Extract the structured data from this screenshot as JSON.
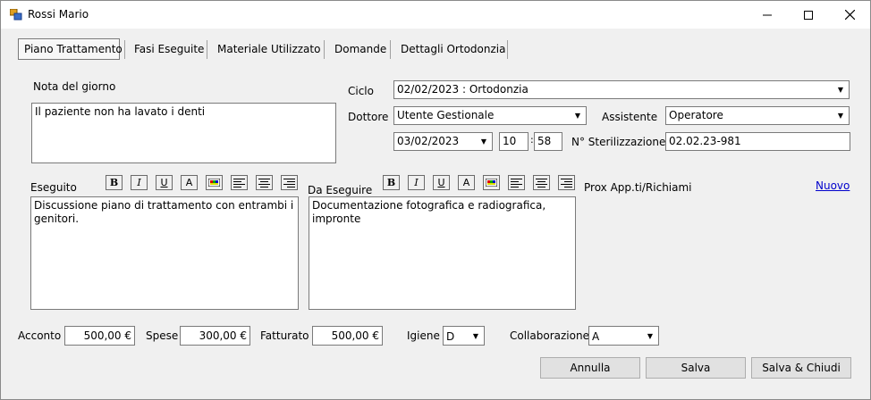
{
  "window": {
    "title": "Rossi Mario"
  },
  "tabs": [
    "Piano Trattamento",
    "Fasi Eseguite",
    "Materiale Utilizzato",
    "Domande",
    "Dettagli Ortodonzia"
  ],
  "nota": {
    "label": "Nota del giorno",
    "value": "Il paziente non ha lavato i denti"
  },
  "ciclo": {
    "label": "Ciclo",
    "value": "02/02/2023 : Ortodonzia"
  },
  "dottore": {
    "label": "Dottore",
    "value": "Utente Gestionale"
  },
  "assistente": {
    "label": "Assistente",
    "value": "Operatore"
  },
  "data": {
    "date": "03/02/2023",
    "hour": "10",
    "sep": ":",
    "minute": "58"
  },
  "sterilizzazione": {
    "label": "N° Sterilizzazione",
    "value": "02.02.23-981"
  },
  "eseguito": {
    "label": "Eseguito",
    "value": "Discussione piano di trattamento con entrambi i genitori."
  },
  "da_eseguire": {
    "label": "Da Eseguire",
    "value": "Documentazione fotografica e radiografica, impronte"
  },
  "format_buttons": {
    "bold": "B",
    "italic": "I",
    "underline": "U",
    "font": "A"
  },
  "prox": {
    "label": "Prox App.ti/Richiami",
    "link": "Nuovo"
  },
  "acconto": {
    "label": "Acconto",
    "value": "500,00 €"
  },
  "spese": {
    "label": "Spese",
    "value": "300,00 €"
  },
  "fatturato": {
    "label": "Fatturato",
    "value": "500,00 €"
  },
  "igiene": {
    "label": "Igiene",
    "value": "D"
  },
  "collaborazione": {
    "label": "Collaborazione",
    "value": "A"
  },
  "buttons": {
    "annulla": "Annulla",
    "salva": "Salva",
    "salva_chiudi": "Salva & Chiudi"
  },
  "colors": {
    "link": "#0000cc",
    "background": "#f0f0f0",
    "titlebar": "#ffffff"
  }
}
